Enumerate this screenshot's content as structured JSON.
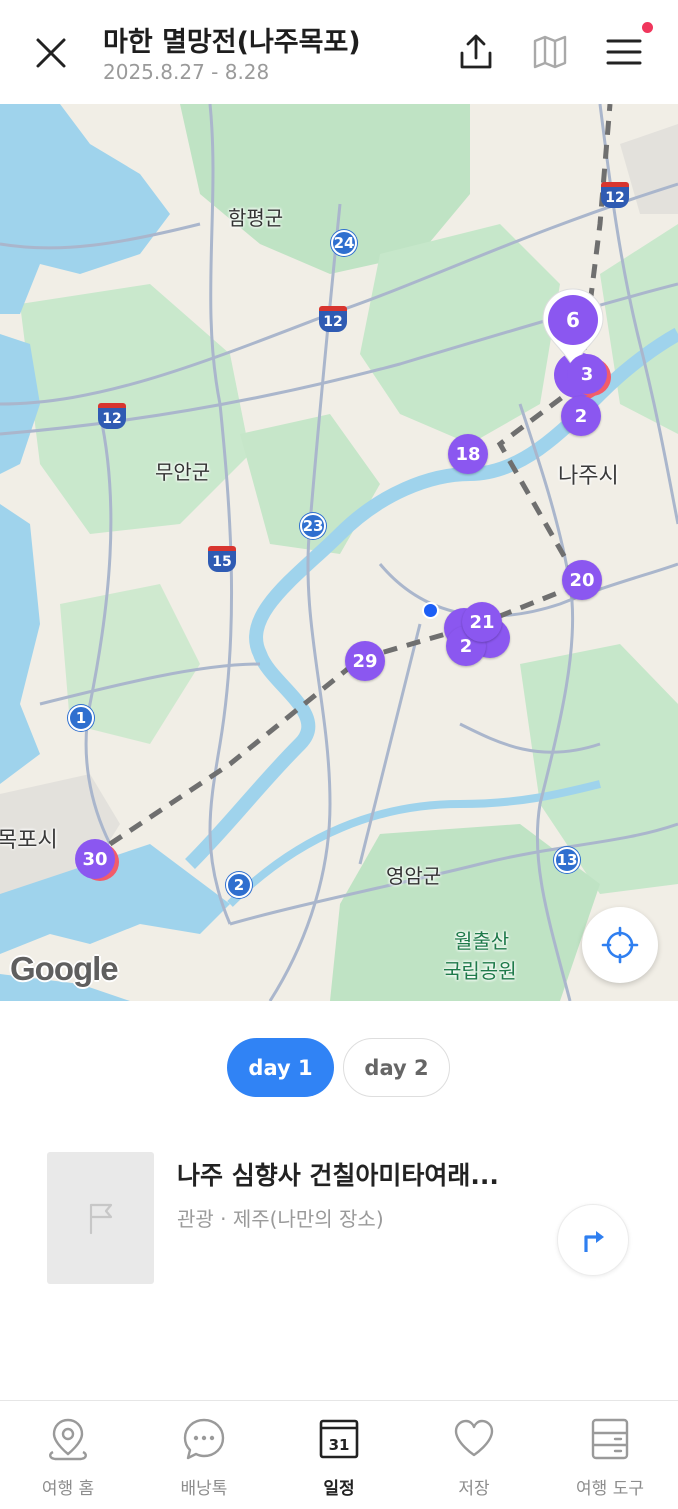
{
  "header": {
    "title": "마한 멸망전(나주목포)",
    "dates": "2025.8.27 - 8.28",
    "icons": [
      "close-icon",
      "share-icon",
      "map-icon",
      "menu-icon"
    ]
  },
  "map": {
    "labels": {
      "hampyeong": "함평군",
      "muan": "무안군",
      "naju": "나주시",
      "mokpo": "목포시",
      "yeongam": "영암군",
      "wolchulsan": "월출산",
      "park": "국립공원"
    },
    "road_numbers": {
      "r12a": "12",
      "r12b": "12",
      "r12c": "12",
      "r24": "24",
      "r23": "23",
      "r15": "15",
      "r1": "1",
      "r2": "2",
      "r13": "13"
    },
    "markers": {
      "m6": "6",
      "m3": "3",
      "m2a": "2",
      "m18": "18",
      "m20": "20",
      "m21": "21",
      "m2b": "2",
      "m29": "29",
      "m30": "30"
    },
    "attribution": "Google",
    "colors": {
      "marker": "#8b57f0",
      "marker_shadow": "#f25c6a",
      "water": "#9fd3ec",
      "park": "#bfe3c4",
      "land": "#f1eee6"
    }
  },
  "days": {
    "day1": "day 1",
    "day2": "day 2",
    "active_color": "#3083f5"
  },
  "place": {
    "name": "나주 심향사 건칠아미타여래...",
    "meta": "관광 · 제주(나만의 장소)"
  },
  "nav": {
    "home": "여행 홈",
    "chat": "배낭톡",
    "schedule": "일정",
    "calendar_day": "31",
    "saved": "저장",
    "tools": "여행 도구"
  }
}
